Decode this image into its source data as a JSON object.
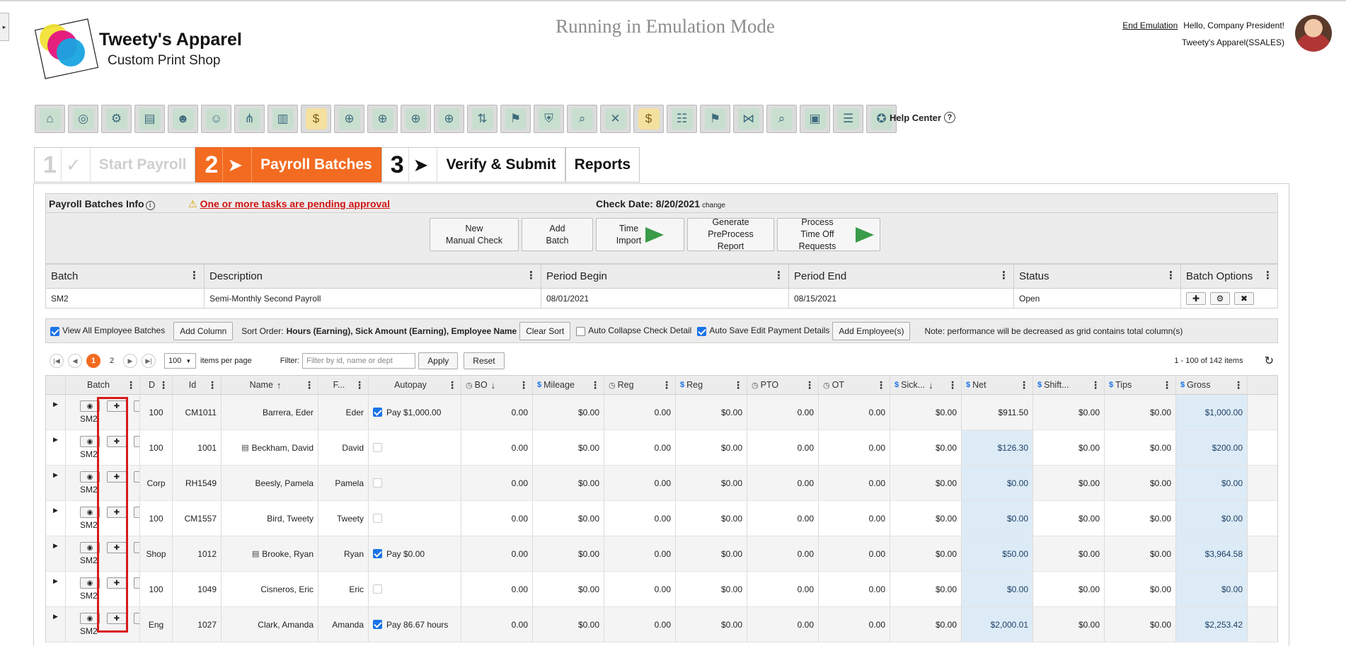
{
  "header": {
    "logo_name": "Tweety's Apparel",
    "logo_sub": "Custom Print Shop",
    "emulation": "Running in Emulation Mode",
    "end_emulation": "End Emulation",
    "greeting": "Hello, Company President!",
    "company": "Tweety's Apparel(SSALES)"
  },
  "toolbar": {
    "icons": [
      "home-icon",
      "org-icon",
      "settings-people-icon",
      "chart-person-icon",
      "group-icon",
      "team-icon",
      "hierarchy-icon",
      "document-icon",
      "money-bag-icon",
      "target-icon",
      "target-icon",
      "target-icon",
      "target-icon",
      "transfer-icon",
      "flag-person-icon",
      "shield-icon",
      "search-doc-icon",
      "target-x-icon",
      "money-bag-icon",
      "group-chart-icon",
      "flag-person-icon",
      "network-icon",
      "magnify-icon",
      "gift-icon",
      "team-board-icon",
      "cert-icon"
    ],
    "help": "Help Center"
  },
  "wizard": [
    {
      "num": "1",
      "arrow": "✓",
      "label": "Start Payroll"
    },
    {
      "num": "2",
      "arrow": "➤",
      "label": "Payroll Batches"
    },
    {
      "num": "3",
      "arrow": "➤",
      "label": "Verify & Submit"
    },
    {
      "label": "Reports"
    }
  ],
  "info": {
    "title": "Payroll Batches Info",
    "warning": "One or more tasks are pending approval",
    "check_date": "Check Date: 8/20/2021",
    "change": "change"
  },
  "actions": [
    {
      "l1": "New",
      "l2": "Manual Check"
    },
    {
      "l1": "Add",
      "l2": "Batch"
    },
    {
      "l1": "Time",
      "l2": "Import"
    },
    {
      "l1": "Generate",
      "l2": "PreProcess Report"
    },
    {
      "l1": "Process",
      "l2": "Time Off Requests"
    }
  ],
  "batch_table": {
    "headers": [
      "Batch",
      "Description",
      "Period Begin",
      "Period End",
      "Status",
      "Batch Options"
    ],
    "row": [
      "SM2",
      "Semi-Monthly Second Payroll",
      "08/01/2021",
      "08/15/2021",
      "Open"
    ]
  },
  "options": {
    "view_all": "View All Employee Batches",
    "add_column": "Add Column",
    "sort_label": "Sort Order:",
    "sort_value": "Hours (Earning), Sick Amount (Earning), Employee Name",
    "clear_sort": "Clear Sort",
    "auto_collapse": "Auto Collapse Check Detail",
    "auto_save": "Auto Save Edit Payment Details",
    "add_employees": "Add Employee(s)",
    "note": "Note: performance will be decreased as grid contains total column(s)"
  },
  "pager": {
    "pages": [
      "1",
      "2"
    ],
    "per_page": "100",
    "per_page_label": "items per page",
    "filter_label": "Filter:",
    "filter_placeholder": "Filter by id, name or dept",
    "apply": "Apply",
    "reset": "Reset",
    "summary": "1 - 100 of 142 items"
  },
  "grid": {
    "headers": [
      "Batch",
      "D",
      "Id",
      "Name",
      "F...",
      "Autopay",
      "BO",
      "Mileage",
      "Reg",
      "Reg",
      "PTO",
      "OT",
      "Sick...",
      "Net",
      "Shift...",
      "Tips",
      "Gross"
    ],
    "rows": [
      {
        "batch": "SM2",
        "d": "100",
        "id": "CM1011",
        "name": "Barrera, Eder",
        "doc": false,
        "f": "Eder",
        "auto": true,
        "pay": "Pay $1,000.00",
        "bo": "0.00",
        "mileage": "$0.00",
        "reg_h": "0.00",
        "reg": "$0.00",
        "pto": "0.00",
        "ot": "0.00",
        "sick": "$0.00",
        "net": "$911.50",
        "shift": "$0.00",
        "tips": "$0.00",
        "gross": "$1,000.00",
        "hl": false
      },
      {
        "batch": "SM2",
        "d": "100",
        "id": "1001",
        "name": "Beckham, David",
        "doc": true,
        "f": "David",
        "auto": false,
        "pay": "",
        "bo": "0.00",
        "mileage": "$0.00",
        "reg_h": "0.00",
        "reg": "$0.00",
        "pto": "0.00",
        "ot": "0.00",
        "sick": "$0.00",
        "net": "$126.30",
        "shift": "$0.00",
        "tips": "$0.00",
        "gross": "$200.00",
        "hl": true
      },
      {
        "batch": "SM2",
        "d": "Corp",
        "id": "RH1549",
        "name": "Beesly, Pamela",
        "doc": false,
        "f": "Pamela",
        "auto": false,
        "pay": "",
        "bo": "0.00",
        "mileage": "$0.00",
        "reg_h": "0.00",
        "reg": "$0.00",
        "pto": "0.00",
        "ot": "0.00",
        "sick": "$0.00",
        "net": "$0.00",
        "shift": "$0.00",
        "tips": "$0.00",
        "gross": "$0.00",
        "hl": true
      },
      {
        "batch": "SM2",
        "d": "100",
        "id": "CM1557",
        "name": "Bird, Tweety",
        "doc": false,
        "f": "Tweety",
        "auto": false,
        "pay": "",
        "bo": "0.00",
        "mileage": "$0.00",
        "reg_h": "0.00",
        "reg": "$0.00",
        "pto": "0.00",
        "ot": "0.00",
        "sick": "$0.00",
        "net": "$0.00",
        "shift": "$0.00",
        "tips": "$0.00",
        "gross": "$0.00",
        "hl": true
      },
      {
        "batch": "SM2",
        "d": "Shop",
        "id": "1012",
        "name": "Brooke, Ryan",
        "doc": true,
        "f": "Ryan",
        "auto": true,
        "pay": "Pay $0.00",
        "bo": "0.00",
        "mileage": "$0.00",
        "reg_h": "0.00",
        "reg": "$0.00",
        "pto": "0.00",
        "ot": "0.00",
        "sick": "$0.00",
        "net": "$50.00",
        "shift": "$0.00",
        "tips": "$0.00",
        "gross": "$3,964.58",
        "hl": true
      },
      {
        "batch": "SM2",
        "d": "100",
        "id": "1049",
        "name": "Cisneros, Eric",
        "doc": false,
        "f": "Eric",
        "auto": false,
        "pay": "",
        "bo": "0.00",
        "mileage": "$0.00",
        "reg_h": "0.00",
        "reg": "$0.00",
        "pto": "0.00",
        "ot": "0.00",
        "sick": "$0.00",
        "net": "$0.00",
        "shift": "$0.00",
        "tips": "$0.00",
        "gross": "$0.00",
        "hl": true
      },
      {
        "batch": "SM2",
        "d": "Eng",
        "id": "1027",
        "name": "Clark, Amanda",
        "doc": false,
        "f": "Amanda",
        "auto": true,
        "pay": "Pay 86.67 hours",
        "bo": "0.00",
        "mileage": "$0.00",
        "reg_h": "0.00",
        "reg": "$0.00",
        "pto": "0.00",
        "ot": "0.00",
        "sick": "$0.00",
        "net": "$2,000.01",
        "shift": "$0.00",
        "tips": "$0.00",
        "gross": "$2,253.42",
        "hl": true
      }
    ]
  },
  "colors": {
    "accent": "#f36b21",
    "highlight": "#ddebf6",
    "warning": "#d01212",
    "check": "#1a73e8"
  }
}
